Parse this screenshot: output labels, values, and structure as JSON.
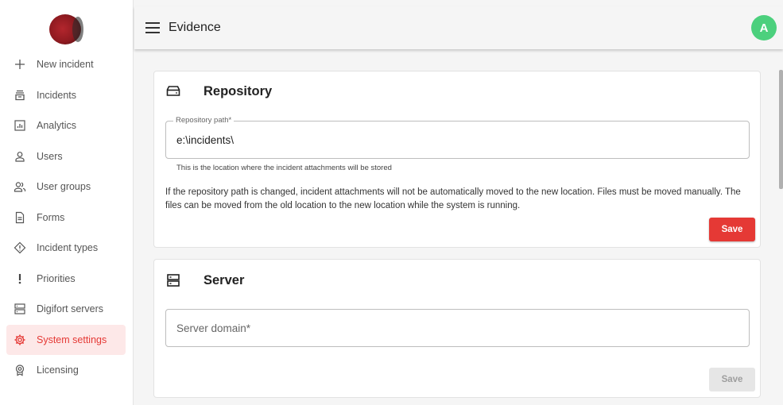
{
  "header": {
    "title": "Evidence",
    "avatar_initial": "A"
  },
  "sidebar": {
    "items": [
      {
        "label": "New incident",
        "icon": "plus-icon"
      },
      {
        "label": "Incidents",
        "icon": "inbox-stack-icon"
      },
      {
        "label": "Analytics",
        "icon": "bar-chart-icon"
      },
      {
        "label": "Users",
        "icon": "user-icon"
      },
      {
        "label": "User groups",
        "icon": "user-group-icon"
      },
      {
        "label": "Forms",
        "icon": "form-icon"
      },
      {
        "label": "Incident types",
        "icon": "diamond-alert-icon"
      },
      {
        "label": "Priorities",
        "icon": "exclamation-icon"
      },
      {
        "label": "Digifort servers",
        "icon": "server-icon"
      },
      {
        "label": "System settings",
        "icon": "gear-icon",
        "active": true
      },
      {
        "label": "Licensing",
        "icon": "badge-icon"
      }
    ]
  },
  "repository": {
    "title": "Repository",
    "path_label": "Repository path*",
    "path_value": "e:\\incidents\\",
    "hint": "This is the location where the incident attachments will be stored",
    "notice": "If the repository path is changed, incident attachments will not be automatically moved to the new location. Files must be moved manually. The files can be moved from the old location to the new location while the system is running.",
    "save_label": "Save"
  },
  "server": {
    "title": "Server",
    "domain_placeholder": "Server domain*",
    "save_label": "Save"
  },
  "colors": {
    "accent": "#e53935",
    "active_bg": "#fde8e8",
    "avatar": "#4cd07d"
  }
}
